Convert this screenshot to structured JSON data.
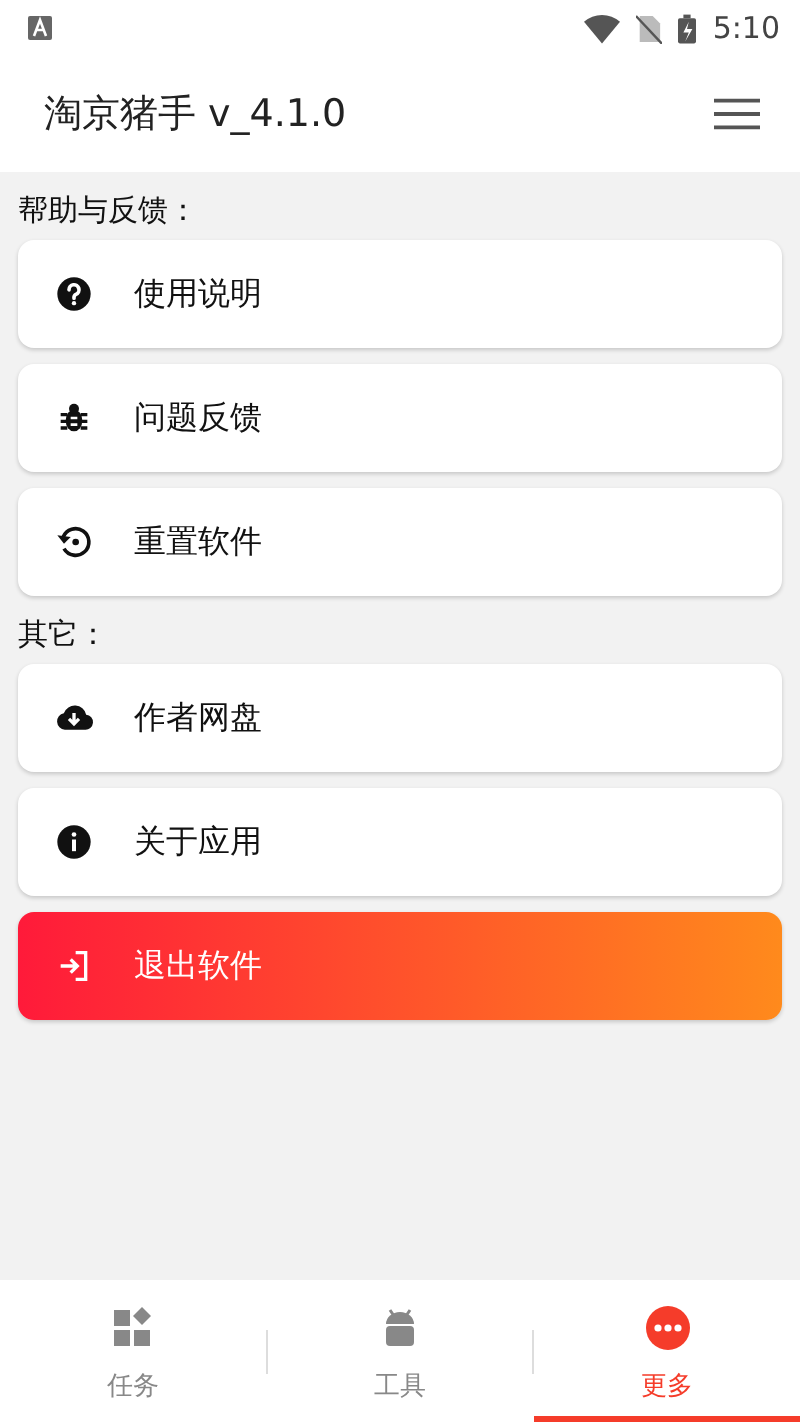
{
  "status_bar": {
    "time": "5:10"
  },
  "app_bar": {
    "title": "淘京猪手 v_4.1.0"
  },
  "sections": [
    {
      "title": "帮助与反馈：",
      "items": [
        {
          "kind": "help",
          "label": "使用说明"
        },
        {
          "kind": "bug",
          "label": "问题反馈"
        },
        {
          "kind": "reset",
          "label": "重置软件"
        }
      ]
    },
    {
      "title": "其它：",
      "items": [
        {
          "kind": "cloud",
          "label": "作者网盘"
        },
        {
          "kind": "info",
          "label": "关于应用"
        }
      ]
    }
  ],
  "exit_button": {
    "label": "退出软件"
  },
  "bottom_nav": [
    {
      "kind": "tasks",
      "label": "任务",
      "selected": false
    },
    {
      "kind": "tools",
      "label": "工具",
      "selected": false
    },
    {
      "kind": "more",
      "label": "更多",
      "selected": true
    }
  ]
}
